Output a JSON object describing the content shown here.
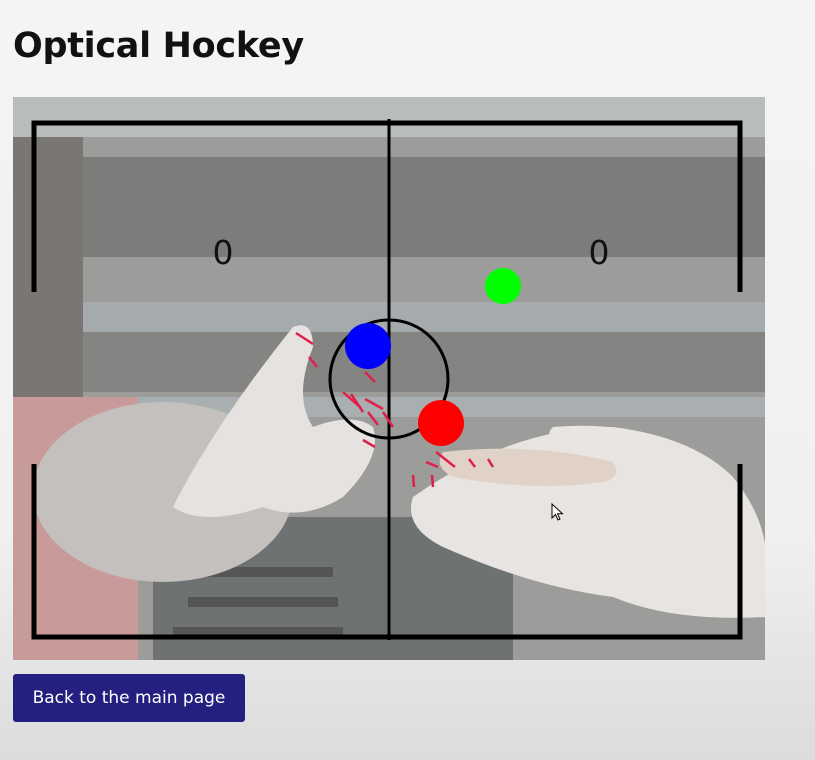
{
  "page": {
    "title": "Optical Hockey"
  },
  "game": {
    "score_left": "0",
    "score_right": "0",
    "colors": {
      "player_left_paddle": "#0000ff",
      "player_right_paddle": "#ff0000",
      "puck": "#00ff00",
      "rink_lines": "#000000",
      "motion_markers": "#e0204a"
    }
  },
  "actions": {
    "back_label": "Back to the main page"
  },
  "icons": {
    "cursor": "mouse-pointer-icon"
  }
}
